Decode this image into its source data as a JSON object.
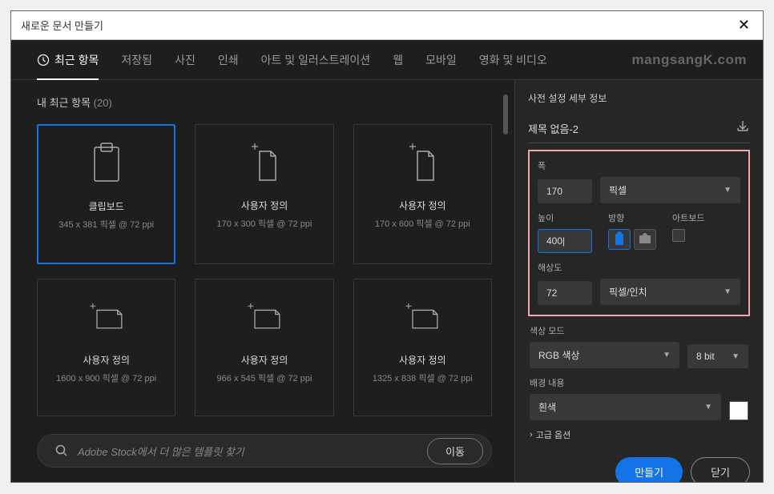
{
  "window": {
    "title": "새로운 문서 만들기"
  },
  "tabs": [
    {
      "id": "recent",
      "label": "최근 항목",
      "active": true
    },
    {
      "id": "saved",
      "label": "저장됨"
    },
    {
      "id": "photo",
      "label": "사진"
    },
    {
      "id": "print",
      "label": "인쇄"
    },
    {
      "id": "art",
      "label": "아트 및 일러스트레이션"
    },
    {
      "id": "web",
      "label": "웹"
    },
    {
      "id": "mobile",
      "label": "모바일"
    },
    {
      "id": "film",
      "label": "영화 및 비디오"
    }
  ],
  "watermark": "mangsangK.com",
  "recent": {
    "title": "내 최근 항목",
    "count": "(20)"
  },
  "presets": [
    {
      "name": "클립보드",
      "dims": "345 x 381 픽셀 @ 72 ppi",
      "type": "clipboard",
      "selected": true
    },
    {
      "name": "사용자 정의",
      "dims": "170 x 300 픽셀 @ 72 ppi",
      "type": "portrait"
    },
    {
      "name": "사용자 정의",
      "dims": "170 x 600 픽셀 @ 72 ppi",
      "type": "portrait"
    },
    {
      "name": "사용자 정의",
      "dims": "1600 x 900 픽셀 @ 72 ppi",
      "type": "landscape"
    },
    {
      "name": "사용자 정의",
      "dims": "966 x 545 픽셀 @ 72 ppi",
      "type": "landscape"
    },
    {
      "name": "사용자 정의",
      "dims": "1325 x 838 픽셀 @ 72 ppi",
      "type": "landscape"
    }
  ],
  "search": {
    "placeholder": "Adobe Stock에서 더 많은 템플릿 찾기",
    "goLabel": "이동"
  },
  "details": {
    "title": "사전 설정 세부 정보",
    "docName": "제목 없음-2",
    "widthLabel": "폭",
    "widthValue": "170",
    "unitValue": "픽셀",
    "heightLabel": "높이",
    "heightValue": "400",
    "orientationLabel": "방향",
    "artboardLabel": "아트보드",
    "resolutionLabel": "해상도",
    "resolutionValue": "72",
    "resolutionUnit": "픽셀/인치",
    "colorModeLabel": "색상 모드",
    "colorModeValue": "RGB 색상",
    "bitDepthValue": "8 bit",
    "backgroundLabel": "배경 내용",
    "backgroundValue": "흰색",
    "advancedLabel": "고급 옵션"
  },
  "buttons": {
    "create": "만들기",
    "close": "닫기"
  }
}
